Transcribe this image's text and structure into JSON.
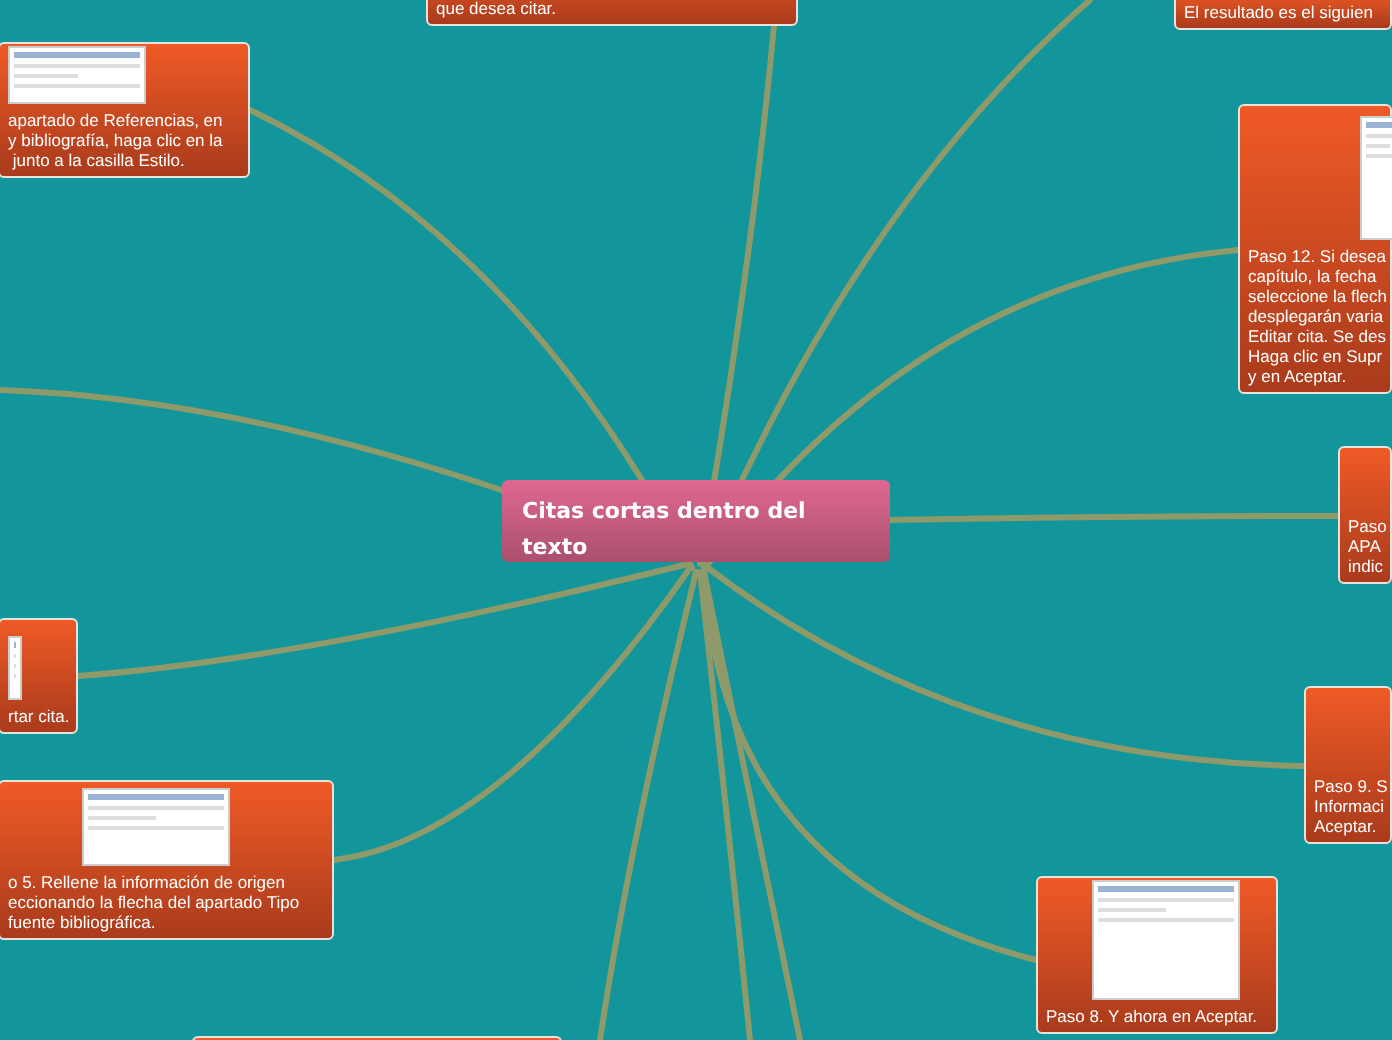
{
  "map": {
    "root": {
      "title": "Citas cortas dentro del texto"
    },
    "nodes": [
      {
        "kind": "text",
        "text": "que desea citar."
      },
      {
        "kind": "text",
        "text": "El resultado es el siguien"
      },
      {
        "kind": "screenshot-step",
        "text": "apartado de Referencias, en\ny bibliografía, haga clic en la\n junto a la casilla Estilo."
      },
      {
        "kind": "screenshot-step",
        "text": "Paso 12. Si desea\ncapítulo, la fecha\nseleccione la flech\ndesplegarán varia\nEditar cita. Se des\nHaga clic en Supr\ny en Aceptar."
      },
      {
        "kind": "text",
        "text": "Paso\nAPA\nindic"
      },
      {
        "kind": "screenshot-step",
        "text": "rtar cita."
      },
      {
        "kind": "screenshot-step",
        "text": "o 5. Rellene la información de origen\neccionando la flecha del apartado Tipo\nfuente bibliográfica."
      },
      {
        "kind": "text",
        "text": "Paso 9. S\nInformaci\nAceptar."
      },
      {
        "kind": "screenshot-step",
        "text": "Paso 8. Y ahora en Aceptar."
      },
      {
        "kind": "empty"
      }
    ]
  }
}
